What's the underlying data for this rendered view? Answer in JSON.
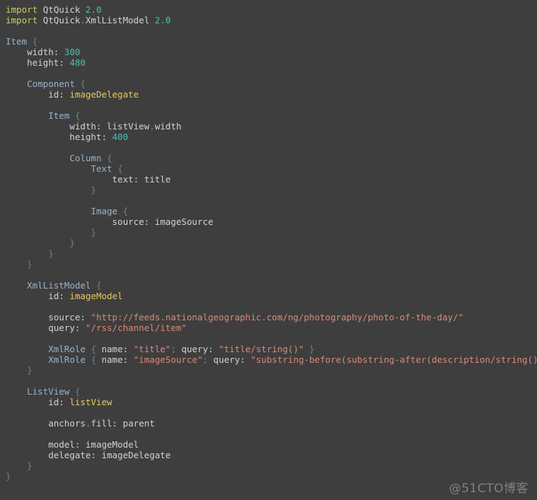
{
  "editor": {
    "background_color": "#3e3e3e",
    "language": "QML",
    "colors": {
      "keyword": "#cdcd5a",
      "text": "#d3d3d3",
      "type": "#98b3cd",
      "number": "#4bbfae",
      "string": "#d98a78",
      "id_value": "#e5c95c",
      "punctuation": "#5f8a80",
      "watermark": "#8d8d8d"
    }
  },
  "watermark": {
    "label": "@51CTO博客"
  },
  "code": {
    "lines": [
      {
        "n": 1,
        "text": "import QtQuick 2.0"
      },
      {
        "n": 2,
        "text": "import QtQuick.XmlListModel 2.0"
      },
      {
        "n": 3,
        "text": ""
      },
      {
        "n": 4,
        "text": "Item {"
      },
      {
        "n": 5,
        "text": "    width: 300"
      },
      {
        "n": 6,
        "text": "    height: 480"
      },
      {
        "n": 7,
        "text": ""
      },
      {
        "n": 8,
        "text": "    Component {"
      },
      {
        "n": 9,
        "text": "        id: imageDelegate"
      },
      {
        "n": 10,
        "text": ""
      },
      {
        "n": 11,
        "text": "        Item {"
      },
      {
        "n": 12,
        "text": "            width: listView.width"
      },
      {
        "n": 13,
        "text": "            height: 400"
      },
      {
        "n": 14,
        "text": ""
      },
      {
        "n": 15,
        "text": "            Column {"
      },
      {
        "n": 16,
        "text": "                Text {"
      },
      {
        "n": 17,
        "text": "                    text: title"
      },
      {
        "n": 18,
        "text": "                }"
      },
      {
        "n": 19,
        "text": ""
      },
      {
        "n": 20,
        "text": "                Image {"
      },
      {
        "n": 21,
        "text": "                    source: imageSource"
      },
      {
        "n": 22,
        "text": "                }"
      },
      {
        "n": 23,
        "text": "            }"
      },
      {
        "n": 24,
        "text": "        }"
      },
      {
        "n": 25,
        "text": "    }"
      },
      {
        "n": 26,
        "text": ""
      },
      {
        "n": 27,
        "text": "    XmlListModel {"
      },
      {
        "n": 28,
        "text": "        id: imageModel"
      },
      {
        "n": 29,
        "text": ""
      },
      {
        "n": 30,
        "text": "        source: \"http://feeds.nationalgeographic.com/ng/photography/photo-of-the-day/\""
      },
      {
        "n": 31,
        "text": "        query: \"/rss/channel/item\""
      },
      {
        "n": 32,
        "text": ""
      },
      {
        "n": 33,
        "text": "        XmlRole { name: \"title\"; query: \"title/string()\" }"
      },
      {
        "n": 34,
        "text": "        XmlRole { name: \"imageSource\"; query: \"substring-before(substring-after(description/string(), 'img src=\\\"'), '\\\"')\" }"
      },
      {
        "n": 35,
        "text": "    }"
      },
      {
        "n": 36,
        "text": ""
      },
      {
        "n": 37,
        "text": "    ListView {"
      },
      {
        "n": 38,
        "text": "        id: listView"
      },
      {
        "n": 39,
        "text": ""
      },
      {
        "n": 40,
        "text": "        anchors.fill: parent"
      },
      {
        "n": 41,
        "text": ""
      },
      {
        "n": 42,
        "text": "        model: imageModel"
      },
      {
        "n": 43,
        "text": "        delegate: imageDelegate"
      },
      {
        "n": 44,
        "text": "    }"
      },
      {
        "n": 45,
        "text": "}"
      }
    ],
    "rendered": [
      {
        "row": 1,
        "tokens": [
          {
            "t": "import",
            "c": "kw"
          },
          {
            "t": " ",
            "c": "plain"
          },
          {
            "t": "QtQuick",
            "c": "plain"
          },
          {
            "t": " ",
            "c": "plain"
          },
          {
            "t": "2.0",
            "c": "num"
          }
        ]
      },
      {
        "row": 2,
        "tokens": [
          {
            "t": "import",
            "c": "kw"
          },
          {
            "t": " ",
            "c": "plain"
          },
          {
            "t": "QtQuick",
            "c": "plain"
          },
          {
            "t": ".",
            "c": "dot"
          },
          {
            "t": "XmlListModel",
            "c": "plain"
          },
          {
            "t": " ",
            "c": "plain"
          },
          {
            "t": "2.0",
            "c": "num"
          }
        ]
      },
      {
        "row": 3,
        "tokens": []
      },
      {
        "row": 4,
        "tokens": [
          {
            "t": "Item",
            "c": "type"
          },
          {
            "t": " ",
            "c": "plain"
          },
          {
            "t": "{",
            "c": "punct"
          }
        ]
      },
      {
        "row": 5,
        "tokens": [
          {
            "t": "    width:",
            "c": "plain"
          },
          {
            "t": " ",
            "c": "plain"
          },
          {
            "t": "300",
            "c": "num"
          }
        ]
      },
      {
        "row": 6,
        "tokens": [
          {
            "t": "    height:",
            "c": "plain"
          },
          {
            "t": " ",
            "c": "plain"
          },
          {
            "t": "480",
            "c": "num"
          }
        ]
      },
      {
        "row": 7,
        "tokens": []
      },
      {
        "row": 8,
        "tokens": [
          {
            "t": "    ",
            "c": "plain"
          },
          {
            "t": "Component",
            "c": "type"
          },
          {
            "t": " ",
            "c": "plain"
          },
          {
            "t": "{",
            "c": "punct"
          }
        ]
      },
      {
        "row": 9,
        "tokens": [
          {
            "t": "        id:",
            "c": "plain"
          },
          {
            "t": " ",
            "c": "plain"
          },
          {
            "t": "imageDelegate",
            "c": "id"
          }
        ]
      },
      {
        "row": 10,
        "tokens": []
      },
      {
        "row": 11,
        "tokens": [
          {
            "t": "        ",
            "c": "plain"
          },
          {
            "t": "Item",
            "c": "type"
          },
          {
            "t": " ",
            "c": "plain"
          },
          {
            "t": "{",
            "c": "punct"
          }
        ]
      },
      {
        "row": 12,
        "tokens": [
          {
            "t": "            width:",
            "c": "plain"
          },
          {
            "t": " ",
            "c": "plain"
          },
          {
            "t": "listView",
            "c": "plain"
          },
          {
            "t": ".",
            "c": "dot"
          },
          {
            "t": "width",
            "c": "plain"
          }
        ]
      },
      {
        "row": 13,
        "tokens": [
          {
            "t": "            height:",
            "c": "plain"
          },
          {
            "t": " ",
            "c": "plain"
          },
          {
            "t": "400",
            "c": "num"
          }
        ]
      },
      {
        "row": 14,
        "tokens": []
      },
      {
        "row": 15,
        "tokens": [
          {
            "t": "            ",
            "c": "plain"
          },
          {
            "t": "Column",
            "c": "type"
          },
          {
            "t": " ",
            "c": "plain"
          },
          {
            "t": "{",
            "c": "punct"
          }
        ]
      },
      {
        "row": 16,
        "tokens": [
          {
            "t": "                ",
            "c": "plain"
          },
          {
            "t": "Text",
            "c": "type"
          },
          {
            "t": " ",
            "c": "plain"
          },
          {
            "t": "{",
            "c": "punct"
          }
        ]
      },
      {
        "row": 17,
        "tokens": [
          {
            "t": "                    text:",
            "c": "plain"
          },
          {
            "t": " ",
            "c": "plain"
          },
          {
            "t": "title",
            "c": "plain"
          }
        ]
      },
      {
        "row": 18,
        "tokens": [
          {
            "t": "                ",
            "c": "plain"
          },
          {
            "t": "}",
            "c": "punct"
          }
        ]
      },
      {
        "row": 19,
        "tokens": []
      },
      {
        "row": 20,
        "tokens": [
          {
            "t": "                ",
            "c": "plain"
          },
          {
            "t": "Image",
            "c": "type"
          },
          {
            "t": " ",
            "c": "plain"
          },
          {
            "t": "{",
            "c": "punct"
          }
        ]
      },
      {
        "row": 21,
        "tokens": [
          {
            "t": "                    source:",
            "c": "plain"
          },
          {
            "t": " ",
            "c": "plain"
          },
          {
            "t": "imageSource",
            "c": "plain"
          }
        ]
      },
      {
        "row": 22,
        "tokens": [
          {
            "t": "                ",
            "c": "plain"
          },
          {
            "t": "}",
            "c": "punct"
          }
        ]
      },
      {
        "row": 23,
        "tokens": [
          {
            "t": "            ",
            "c": "plain"
          },
          {
            "t": "}",
            "c": "punct"
          }
        ]
      },
      {
        "row": 24,
        "tokens": [
          {
            "t": "        ",
            "c": "plain"
          },
          {
            "t": "}",
            "c": "punct"
          }
        ]
      },
      {
        "row": 25,
        "tokens": [
          {
            "t": "    ",
            "c": "plain"
          },
          {
            "t": "}",
            "c": "punct"
          }
        ]
      },
      {
        "row": 26,
        "tokens": []
      },
      {
        "row": 27,
        "tokens": [
          {
            "t": "    ",
            "c": "plain"
          },
          {
            "t": "XmlListModel",
            "c": "type"
          },
          {
            "t": " ",
            "c": "plain"
          },
          {
            "t": "{",
            "c": "punct"
          }
        ]
      },
      {
        "row": 28,
        "tokens": [
          {
            "t": "        id:",
            "c": "plain"
          },
          {
            "t": " ",
            "c": "plain"
          },
          {
            "t": "imageModel",
            "c": "id"
          }
        ]
      },
      {
        "row": 29,
        "tokens": []
      },
      {
        "row": 30,
        "tokens": [
          {
            "t": "        source:",
            "c": "plain"
          },
          {
            "t": " ",
            "c": "plain"
          },
          {
            "t": "\"http://feeds.nationalgeographic.com/ng/photography/photo-of-the-day/\"",
            "c": "str"
          }
        ]
      },
      {
        "row": 31,
        "tokens": [
          {
            "t": "        query:",
            "c": "plain"
          },
          {
            "t": " ",
            "c": "plain"
          },
          {
            "t": "\"/rss/channel/item\"",
            "c": "str"
          }
        ]
      },
      {
        "row": 32,
        "tokens": []
      },
      {
        "row": 33,
        "tokens": [
          {
            "t": "        ",
            "c": "plain"
          },
          {
            "t": "XmlRole",
            "c": "type"
          },
          {
            "t": " ",
            "c": "plain"
          },
          {
            "t": "{",
            "c": "punct"
          },
          {
            "t": " name:",
            "c": "plain"
          },
          {
            "t": " ",
            "c": "plain"
          },
          {
            "t": "\"title\"",
            "c": "str"
          },
          {
            "t": ";",
            "c": "punct"
          },
          {
            "t": " query:",
            "c": "plain"
          },
          {
            "t": " ",
            "c": "plain"
          },
          {
            "t": "\"title/string()\"",
            "c": "str"
          },
          {
            "t": " ",
            "c": "plain"
          },
          {
            "t": "}",
            "c": "punct"
          }
        ]
      },
      {
        "row": 34,
        "tokens": [
          {
            "t": "        ",
            "c": "plain"
          },
          {
            "t": "XmlRole",
            "c": "type"
          },
          {
            "t": " ",
            "c": "plain"
          },
          {
            "t": "{",
            "c": "punct"
          },
          {
            "t": " name:",
            "c": "plain"
          },
          {
            "t": " ",
            "c": "plain"
          },
          {
            "t": "\"imageSource\"",
            "c": "str"
          },
          {
            "t": ";",
            "c": "punct"
          },
          {
            "t": " query:",
            "c": "plain"
          },
          {
            "t": " ",
            "c": "plain"
          },
          {
            "t": "\"substring-before(substring-after(description/string(), 'img src=\\\"'), '\\\"')\"",
            "c": "str"
          },
          {
            "t": " ",
            "c": "plain"
          },
          {
            "t": "}",
            "c": "punct"
          }
        ]
      },
      {
        "row": 35,
        "tokens": [
          {
            "t": "    ",
            "c": "plain"
          },
          {
            "t": "}",
            "c": "punct"
          }
        ]
      },
      {
        "row": 36,
        "tokens": []
      },
      {
        "row": 37,
        "tokens": [
          {
            "t": "    ",
            "c": "plain"
          },
          {
            "t": "ListView",
            "c": "type"
          },
          {
            "t": " ",
            "c": "plain"
          },
          {
            "t": "{",
            "c": "punct"
          }
        ]
      },
      {
        "row": 38,
        "tokens": [
          {
            "t": "        id:",
            "c": "plain"
          },
          {
            "t": " ",
            "c": "plain"
          },
          {
            "t": "listView",
            "c": "id"
          }
        ]
      },
      {
        "row": 39,
        "tokens": []
      },
      {
        "row": 40,
        "tokens": [
          {
            "t": "        anchors",
            "c": "plain"
          },
          {
            "t": ".",
            "c": "dot"
          },
          {
            "t": "fill:",
            "c": "plain"
          },
          {
            "t": " ",
            "c": "plain"
          },
          {
            "t": "parent",
            "c": "plain"
          }
        ]
      },
      {
        "row": 41,
        "tokens": []
      },
      {
        "row": 42,
        "tokens": [
          {
            "t": "        model:",
            "c": "plain"
          },
          {
            "t": " ",
            "c": "plain"
          },
          {
            "t": "imageModel",
            "c": "plain"
          }
        ]
      },
      {
        "row": 43,
        "tokens": [
          {
            "t": "        delegate:",
            "c": "plain"
          },
          {
            "t": " ",
            "c": "plain"
          },
          {
            "t": "imageDelegate",
            "c": "plain"
          }
        ]
      },
      {
        "row": 44,
        "tokens": [
          {
            "t": "    ",
            "c": "plain"
          },
          {
            "t": "}",
            "c": "punct"
          }
        ]
      },
      {
        "row": 45,
        "tokens": [
          {
            "t": "}",
            "c": "punct"
          }
        ]
      }
    ]
  }
}
